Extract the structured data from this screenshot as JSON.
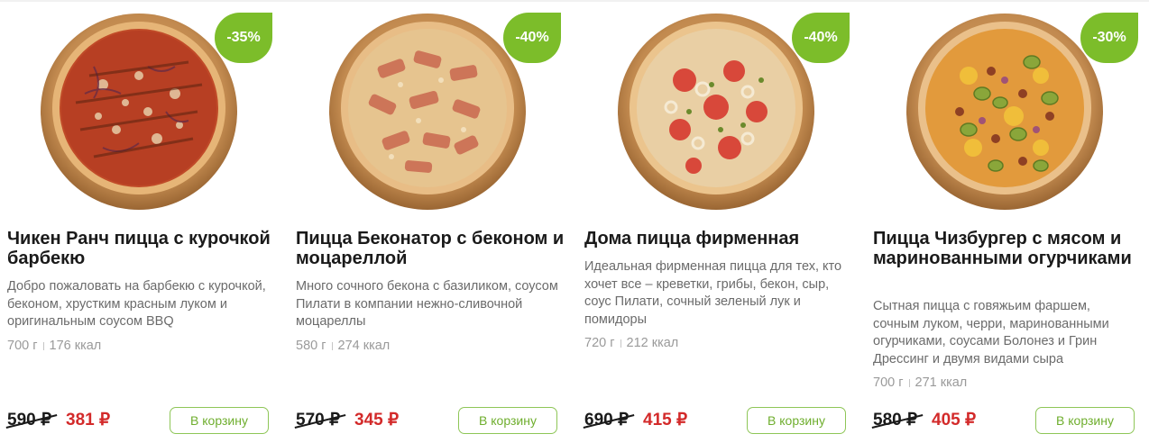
{
  "colors": {
    "badge": "#7cbd2a",
    "new_price": "#d32a2a",
    "button_border": "#8ec657",
    "button_text": "#6fae2e"
  },
  "products": [
    {
      "discount": "-35%",
      "title": "Чикен Ранч пицца с курочкой барбекю",
      "description": "Добро пожаловать на барбекю с курочкой, беконом, хрустким красным луком и оригинальным соусом BBQ",
      "weight": "700 г",
      "calories": "176 ккал",
      "old_price": "590 ₽",
      "price": "381 ₽",
      "button": "В корзину",
      "image": "pizza-chicken-ranch"
    },
    {
      "discount": "-40%",
      "title": "Пицца Беконатор с беконом и моцареллой",
      "description": "Много сочного бекона с базиликом, соусом Пилати в компании нежно-сливочной моцареллы",
      "weight": "580 г",
      "calories": "274 ккал",
      "old_price": "570 ₽",
      "price": "345 ₽",
      "button": "В корзину",
      "image": "pizza-bacon"
    },
    {
      "discount": "-40%",
      "title": "Дома пицца фирменная",
      "description": "Идеальная фирменная пицца для тех, кто хочет все – креветки, грибы, бекон, сыр, соус Пилати, сочный зеленый лук и помидоры",
      "weight": "720 г",
      "calories": "212 ккал",
      "old_price": "690 ₽",
      "price": "415 ₽",
      "button": "В корзину",
      "image": "pizza-house-special"
    },
    {
      "discount": "-30%",
      "title": "Пицца Чизбургер с мясом и маринованными огурчиками",
      "description": "Сытная пицца с говяжьим фаршем, сочным луком, черри, маринованными огурчиками, соусами Болонез и Грин Дрессинг и двумя видами сыра",
      "weight": "700 г",
      "calories": "271 ккал",
      "old_price": "580 ₽",
      "price": "405 ₽",
      "button": "В корзину",
      "image": "pizza-cheeseburger"
    }
  ]
}
